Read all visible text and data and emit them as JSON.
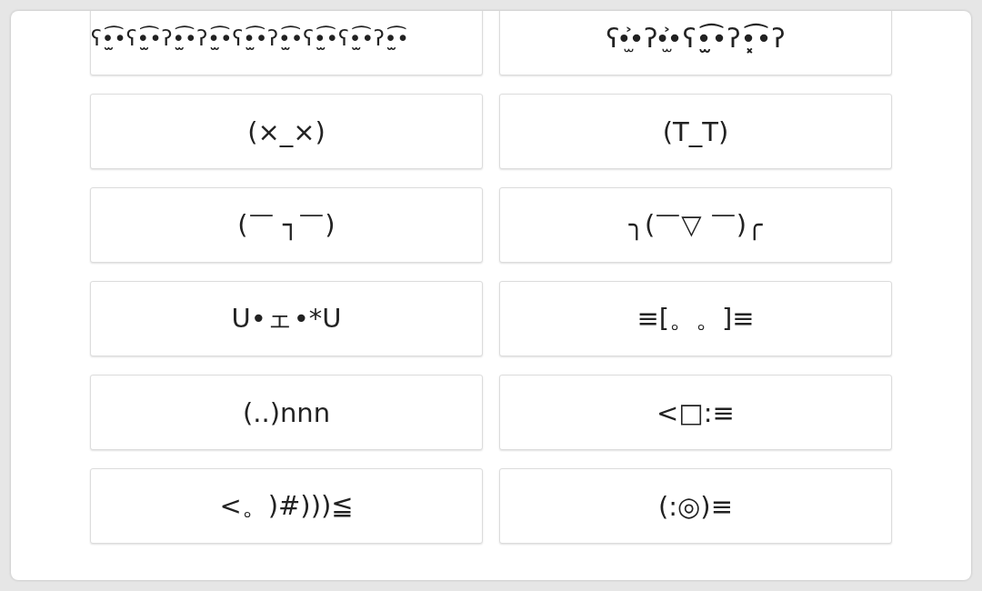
{
  "kaomoji": [
    {
      "text": "ʕ•̫͡•ʕ•̫͡•ʔ•̫͡•ʔ•̫͡•ʕ•̫͡•ʔ•̫͡•ʕ•̫͡•ʕ•̫͡•ʔ•̫͡•"
    },
    {
      "text": "ʕ•̫͐•ʔ•̫͐•ʕ•̫͡•ʔ•͓͡•ʔ"
    },
    {
      "text": "(×_×)"
    },
    {
      "text": "(T_T)"
    },
    {
      "text": "(￣ ┐￣)"
    },
    {
      "text": "╮(￣▽ ￣)╭"
    },
    {
      "text": "U•ェ•*U"
    },
    {
      "text": "≡[。。]≡"
    },
    {
      "text": "(..)nnn"
    },
    {
      "text": "<□:≡"
    },
    {
      "text": "<。)#)))≦"
    },
    {
      "text": "(:◎)≡"
    }
  ]
}
